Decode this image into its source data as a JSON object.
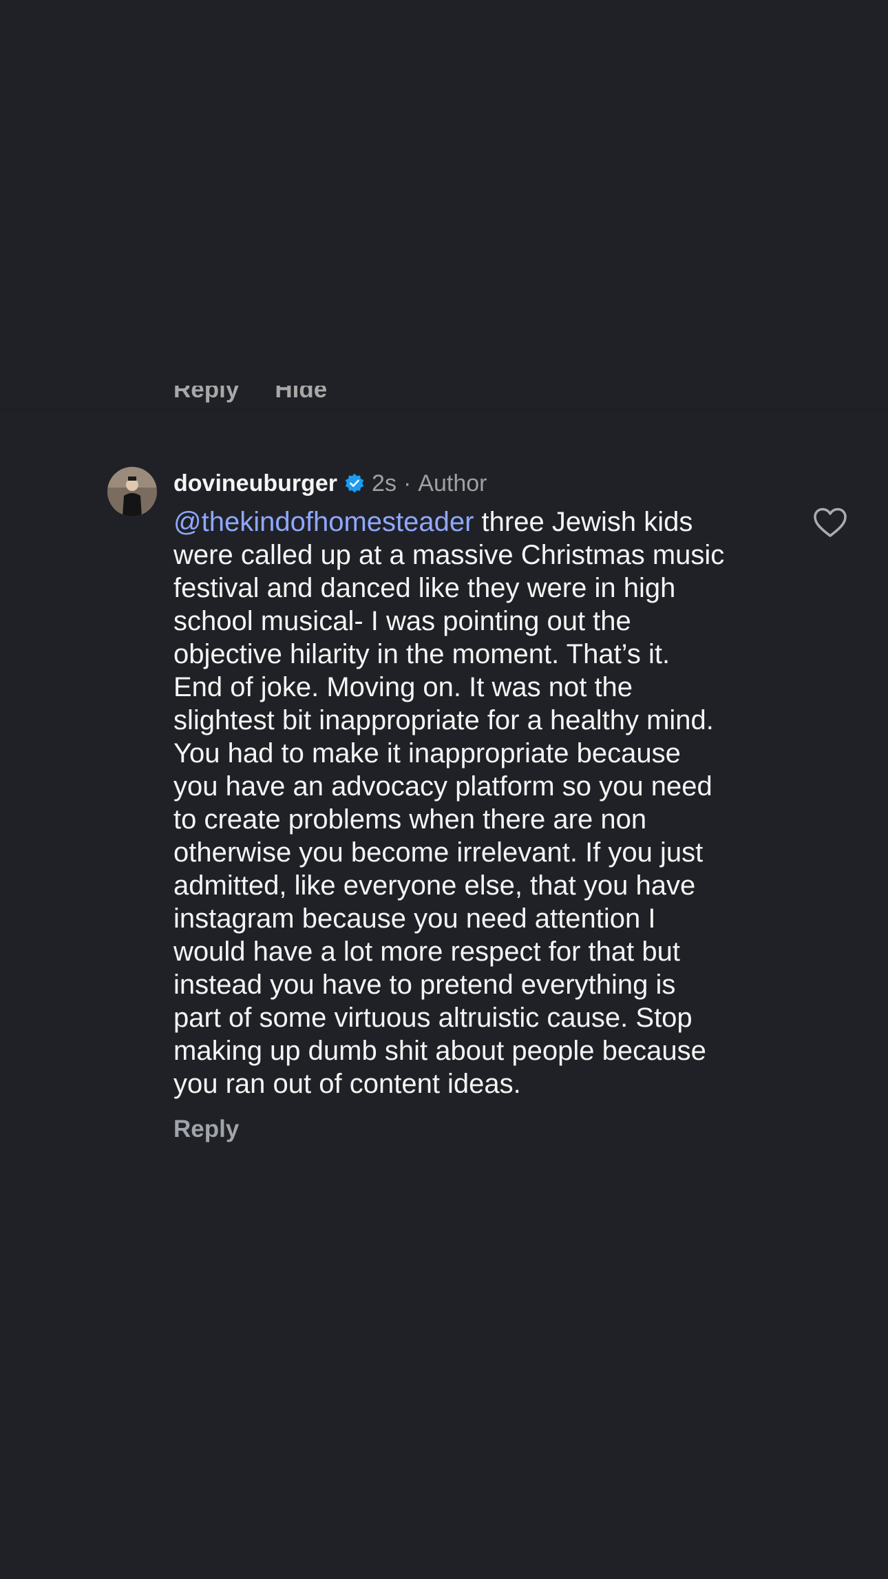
{
  "previous_comment": {
    "reply_label": "Reply",
    "hide_label": "Hide"
  },
  "comment": {
    "username": "dovineuburger",
    "time": "2s",
    "separator": "·",
    "badge": "Author",
    "mention": "@thekindofhomesteader",
    "body_lines": [
      " three Jewish kids",
      "were called up at a massive Christmas music",
      "festival and danced like they were in high",
      "school musical- I was pointing out the",
      "objective hilarity in the moment. That’s it.",
      "End of joke. Moving on. It was not the",
      "slightest bit inappropriate for a healthy mind.",
      "You had to make it inappropriate because",
      "you have an advocacy platform so you need",
      "to create problems when there are non",
      "otherwise you become irrelevant. If you just",
      "admitted, like everyone else, that you have",
      "instagram because you need attention I",
      "would have a lot more respect for that but",
      "instead you have to pretend everything is",
      "part of some virtuous altruistic cause. Stop",
      "making up dumb shit about people because",
      "you ran out of content ideas."
    ],
    "reply_label": "Reply",
    "icons": {
      "verified": "verified-badge-icon",
      "like": "heart-outline-icon"
    },
    "colors": {
      "background": "#202126",
      "mention": "#8fa8ff",
      "verified": "#1d9bf0",
      "secondary_text": "#a0a0a0"
    }
  }
}
